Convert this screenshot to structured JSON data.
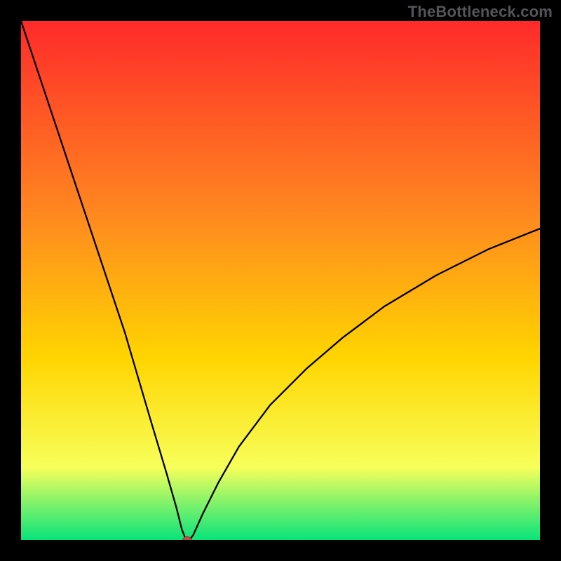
{
  "watermark": "TheBottleneck.com",
  "colors": {
    "gradient_top": "#ff2a2a",
    "gradient_mid1": "#ff8a1f",
    "gradient_mid2": "#ffd500",
    "gradient_mid3": "#f7ff5a",
    "gradient_bottom": "#08e47a",
    "curve": "#000000",
    "marker_fill": "#c24b4a",
    "frame": "#000000"
  },
  "chart_data": {
    "type": "line",
    "title": "",
    "xlabel": "",
    "ylabel": "",
    "xlim": [
      0,
      100
    ],
    "ylim": [
      0,
      100
    ],
    "grid": false,
    "axes_visible": false,
    "series": [
      {
        "name": "bottleneck-curve",
        "x": [
          0,
          5,
          10,
          15,
          20,
          25,
          28,
          30,
          31,
          31.8,
          32.5,
          33.2,
          35,
          38,
          42,
          48,
          55,
          62,
          70,
          80,
          90,
          100
        ],
        "y": [
          100,
          85,
          70,
          55,
          40,
          23,
          13,
          6,
          2,
          0,
          0,
          1,
          5,
          11,
          18,
          26,
          33,
          39,
          45,
          51,
          56,
          60
        ]
      }
    ],
    "marker": {
      "x": 32,
      "y": 0,
      "radius_px": 6
    }
  }
}
